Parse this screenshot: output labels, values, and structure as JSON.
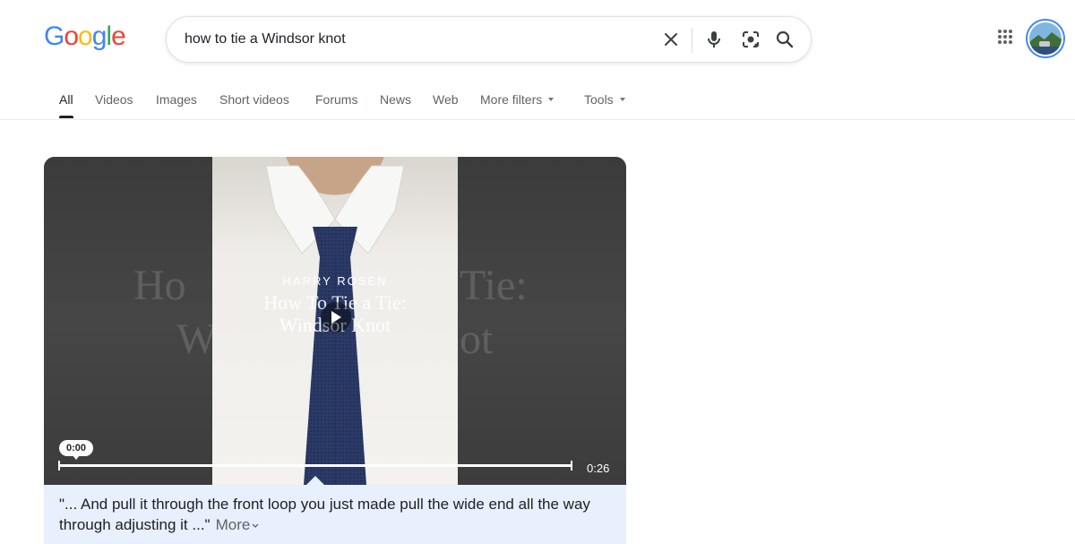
{
  "logo": {
    "text": "Google",
    "letters": [
      "G",
      "o",
      "o",
      "g",
      "l",
      "e"
    ],
    "colors": [
      "#4285f4",
      "#ea4335",
      "#fbbc05",
      "#4285f4",
      "#34a853",
      "#ea4335"
    ]
  },
  "search": {
    "query": "how to tie a Windsor knot",
    "icons": [
      "close-icon",
      "microphone-icon",
      "lens-icon",
      "search-icon"
    ]
  },
  "header_icons": [
    "apps-grid-icon",
    "avatar"
  ],
  "tabs": [
    {
      "label": "All",
      "active": true
    },
    {
      "label": "Videos"
    },
    {
      "label": "Images"
    },
    {
      "label": "Short videos"
    },
    {
      "label": "Forums"
    },
    {
      "label": "News"
    },
    {
      "label": "Web"
    },
    {
      "label": "More filters",
      "dropdown": true
    },
    {
      "label": "Tools",
      "dropdown": true
    }
  ],
  "video": {
    "brand": "HARRY ROSEN",
    "title_line1": "How To Tie a Tie:",
    "title_line2": "Windsor Knot",
    "current_time": "0:00",
    "duration": "0:26",
    "progress": 0,
    "transcript": "\"... And pull it through the front loop you just made pull the wide end all the way through adjusting it ...\"",
    "more_label": "More"
  }
}
